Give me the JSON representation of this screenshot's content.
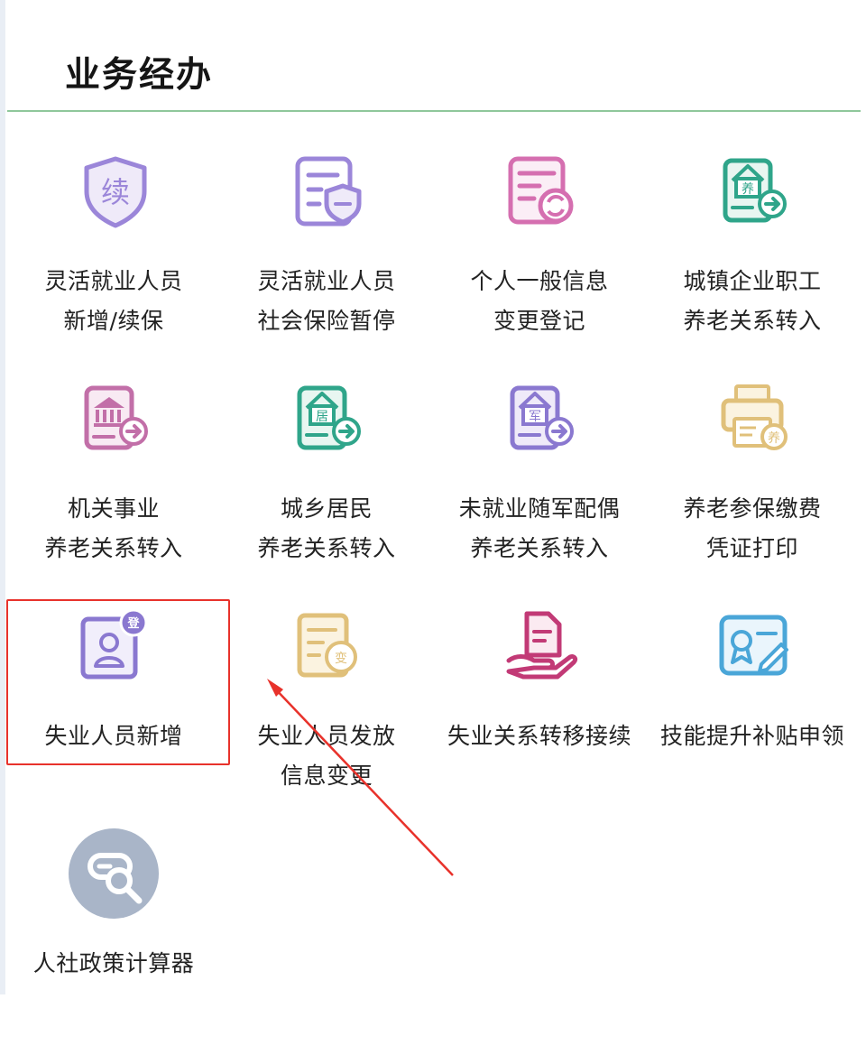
{
  "header": {
    "title": "业务经办"
  },
  "tiles": [
    {
      "line1": "灵活就业人员",
      "line2": "新增/续保",
      "icon": "renewal-shield-icon",
      "badge": "续",
      "color": "#9b86d9"
    },
    {
      "line1": "灵活就业人员",
      "line2": "社会保险暂停",
      "icon": "document-shield-icon",
      "badge": "",
      "color": "#9b86d9"
    },
    {
      "line1": "个人一般信息",
      "line2": "变更登记",
      "icon": "document-refresh-icon",
      "badge": "",
      "color": "#d56fb0"
    },
    {
      "line1": "城镇企业职工",
      "line2": "养老关系转入",
      "icon": "pension-transfer-icon",
      "badge": "养",
      "color": "#2fa58a"
    },
    {
      "line1": "机关事业",
      "line2": "养老关系转入",
      "icon": "institution-transfer-icon",
      "badge": "",
      "color": "#c26fa8"
    },
    {
      "line1": "城乡居民",
      "line2": "养老关系转入",
      "icon": "resident-transfer-icon",
      "badge": "居",
      "color": "#2fa58a"
    },
    {
      "line1": "未就业随军配偶",
      "line2": "养老关系转入",
      "icon": "military-spouse-transfer-icon",
      "badge": "军",
      "color": "#8a78d0"
    },
    {
      "line1": "养老参保缴费",
      "line2": "凭证打印",
      "icon": "printer-icon",
      "badge": "养",
      "color": "#e0c07a"
    },
    {
      "line1": "失业人员新增",
      "line2": "",
      "icon": "unemployed-register-icon",
      "badge": "登",
      "color": "#8a78d0"
    },
    {
      "line1": "失业人员发放",
      "line2": "信息变更",
      "icon": "payment-change-icon",
      "badge": "变",
      "color": "#e0c07a"
    },
    {
      "line1": "失业关系转移接续",
      "line2": "",
      "icon": "hand-document-icon",
      "badge": "",
      "color": "#c23a76"
    },
    {
      "line1": "技能提升补贴申领",
      "line2": "",
      "icon": "certificate-edit-icon",
      "badge": "",
      "color": "#4aa6d8"
    },
    {
      "line1": "人社政策计算器",
      "line2": "",
      "icon": "policy-calculator-icon",
      "badge": "",
      "color": "#a9b5c8"
    }
  ]
}
